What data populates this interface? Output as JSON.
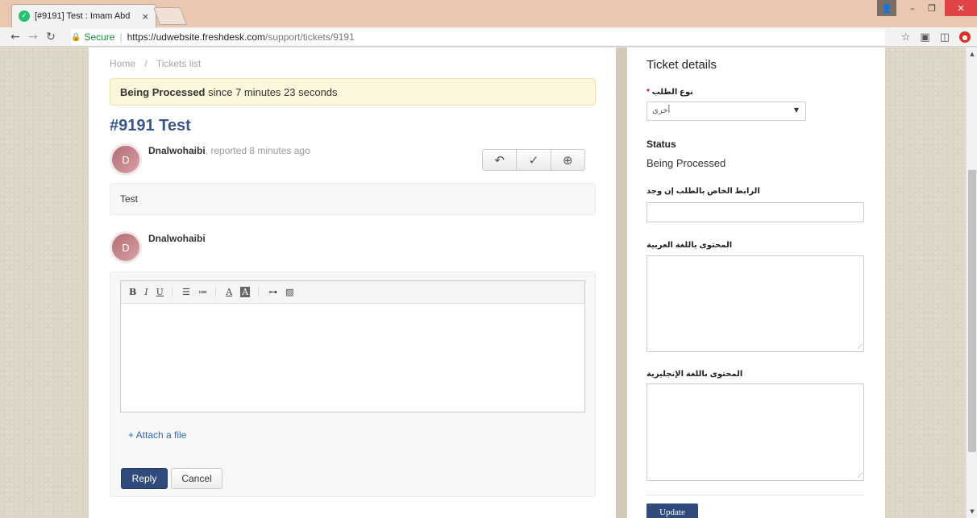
{
  "browser": {
    "tab_title": "[#9191] Test : Imam Abd",
    "tab_close": "×",
    "secure_label": "Secure",
    "url_host": "https://udwebsite.freshdesk.com",
    "url_path": "/support/tickets/9191"
  },
  "breadcrumb": {
    "home": "Home",
    "separator": "/",
    "tickets": "Tickets list"
  },
  "status_banner": {
    "state": "Being Processed",
    "since": " since 7 minutes 23 seconds"
  },
  "ticket": {
    "title": "#9191 Test",
    "reporter_name": "Dnalwohaibi",
    "reporter_meta": ", reported 8 minutes ago",
    "avatar_initial": "D",
    "description": "Test"
  },
  "reply": {
    "author": "Dnalwohaibi",
    "avatar_initial": "D",
    "toolbar": [
      "B",
      "I",
      "U"
    ],
    "attach_label": "+ Attach a file",
    "reply_button": "Reply",
    "cancel_button": "Cancel"
  },
  "sidebar": {
    "title": "Ticket details",
    "request_type_label": "نوع الطلب",
    "request_type_value": "أخرى",
    "required_mark": "*",
    "status_label": "Status",
    "status_value": "Being Processed",
    "link_label": "الرابط الخاص بالطلب إن وجد",
    "arabic_content_label": "المحتوى باللغة العربية",
    "english_content_label": "المحتوى باللغة الإنجليزية",
    "update_button": "Update"
  },
  "colors": {
    "title_blue": "#395589",
    "primary_button": "#2f4b7c",
    "banner_bg": "#fcf7dc",
    "link_blue": "#2b6bb5"
  }
}
